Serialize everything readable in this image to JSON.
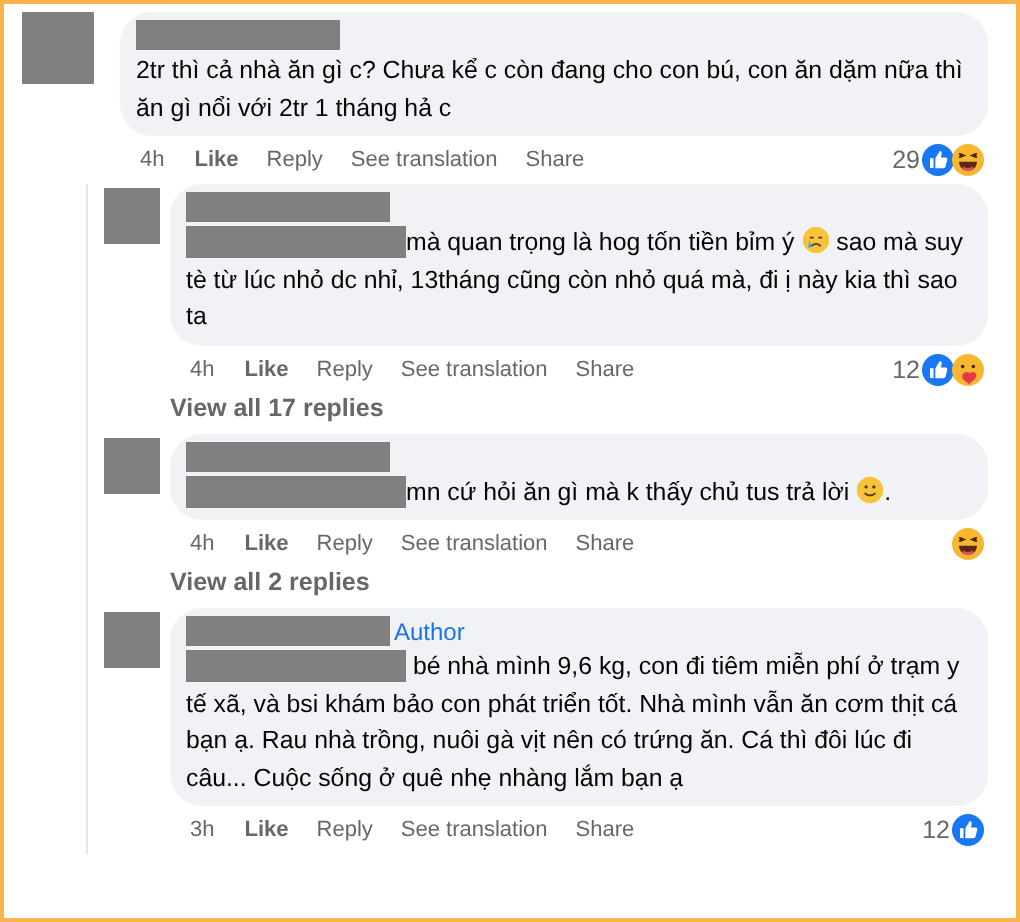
{
  "comment": {
    "parts": [
      {
        "kind": "text",
        "text": "2tr thì cả nhà ăn gì c? Chưa kể c còn đang cho con bú, con ăn dặm nữa thì ăn gì nổi với 2tr 1 tháng hả c"
      }
    ],
    "time": "4h",
    "actions": [
      "Like",
      "Reply",
      "See translation",
      "Share"
    ],
    "count": "29",
    "reactions": [
      {
        "kind": "like"
      },
      {
        "kind": "haha"
      }
    ]
  },
  "replies": [
    {
      "parts": [
        {
          "kind": "text",
          "text": "mà quan trọng là hog tốn tiền bỉm ý "
        },
        {
          "kind": "cry"
        },
        {
          "kind": "text",
          "text": " sao mà suy tè từ lúc nhỏ dc nhỉ, 13tháng cũng còn nhỏ quá mà, đi ị này kia thì sao ta"
        }
      ],
      "time": "4h",
      "actions": [
        "Like",
        "Reply",
        "See translation",
        "Share"
      ],
      "count": "12",
      "reactions": [
        {
          "kind": "like"
        },
        {
          "kind": "care"
        }
      ],
      "more": "View all 17 replies"
    },
    {
      "parts": [
        {
          "kind": "text",
          "text": "mn cứ hỏi ăn gì mà k thấy chủ tus trả lời "
        },
        {
          "kind": "smile"
        },
        {
          "kind": "text",
          "text": "."
        }
      ],
      "time": "4h",
      "actions": [
        "Like",
        "Reply",
        "See translation",
        "Share"
      ],
      "reactions": [
        {
          "kind": "haha"
        }
      ],
      "more": "View all 2 replies"
    },
    {
      "badge": "Author",
      "parts": [
        {
          "kind": "text",
          "text": " bé nhà mình 9,6 kg, con đi tiêm miễn phí ở trạm y tế xã, và bsi khám bảo con phát triển tốt. Nhà mình vẫn ăn cơm thịt cá bạn ạ. Rau nhà trồng, nuôi gà vịt nên có trứng ăn. Cá thì đôi lúc đi câu... Cuộc sống ở quê nhẹ nhàng lắm bạn ạ"
        }
      ],
      "time": "3h",
      "actions": [
        "Like",
        "Reply",
        "See translation",
        "Share"
      ],
      "count": "12",
      "reactions": [
        {
          "kind": "like"
        }
      ]
    }
  ]
}
